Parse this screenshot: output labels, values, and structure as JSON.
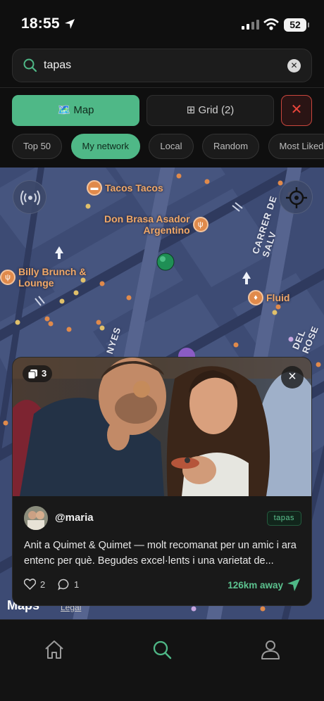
{
  "status_bar": {
    "time": "18:55",
    "battery": "52"
  },
  "search": {
    "value": "tapas",
    "clear_label": "✕"
  },
  "view_toggle": {
    "map_label": "🗺️ Map",
    "grid_label": "⊞ Grid (2)",
    "close_label": "✕"
  },
  "filters": [
    "Top 50",
    "My network",
    "Local",
    "Random",
    "Most Liked"
  ],
  "filters_active": "My network",
  "map": {
    "pois": [
      {
        "name": "Tacos Tacos"
      },
      {
        "name": "Don Brasa Asador\nArgentino"
      },
      {
        "name": "Billy Brunch &\nLounge"
      },
      {
        "name": "Fluid"
      }
    ],
    "streets": [
      "CARRER DE SALV",
      "DEL ROSE",
      "NYES"
    ],
    "maps_brand": "Maps",
    "legal": "Legal"
  },
  "post": {
    "photo_count": "3",
    "username": "@maria",
    "tag": "tapas",
    "caption": "Anit a Quimet & Quimet — molt recomanat per un amic i ara entenc per què. Begudes excel·lents i una varietat de...",
    "likes": "2",
    "comments": "1",
    "distance": "126km away"
  },
  "tabs": [
    "home-icon",
    "search-icon",
    "profile-icon"
  ],
  "colors": {
    "accent": "#4fb887",
    "danger": "#e9453b",
    "poi": "#e08a4b",
    "map_bg": "#3b4a72"
  }
}
